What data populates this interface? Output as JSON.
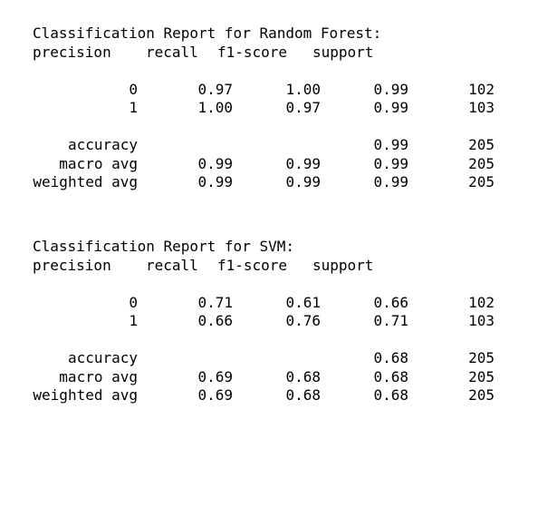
{
  "reports": [
    {
      "title": "Classification Report for Random Forest:",
      "headers": {
        "precision": "precision",
        "recall": "recall",
        "f1": "f1-score",
        "support": "support"
      },
      "class_rows": [
        {
          "label": "0",
          "precision": "0.97",
          "recall": "1.00",
          "f1": "0.99",
          "support": "102"
        },
        {
          "label": "1",
          "precision": "1.00",
          "recall": "0.97",
          "f1": "0.99",
          "support": "103"
        }
      ],
      "summary_rows": [
        {
          "label": "accuracy",
          "precision": "",
          "recall": "",
          "f1": "0.99",
          "support": "205"
        },
        {
          "label": "macro avg",
          "precision": "0.99",
          "recall": "0.99",
          "f1": "0.99",
          "support": "205"
        },
        {
          "label": "weighted avg",
          "precision": "0.99",
          "recall": "0.99",
          "f1": "0.99",
          "support": "205"
        }
      ]
    },
    {
      "title": "Classification Report for SVM:",
      "headers": {
        "precision": "precision",
        "recall": "recall",
        "f1": "f1-score",
        "support": "support"
      },
      "class_rows": [
        {
          "label": "0",
          "precision": "0.71",
          "recall": "0.61",
          "f1": "0.66",
          "support": "102"
        },
        {
          "label": "1",
          "precision": "0.66",
          "recall": "0.76",
          "f1": "0.71",
          "support": "103"
        }
      ],
      "summary_rows": [
        {
          "label": "accuracy",
          "precision": "",
          "recall": "",
          "f1": "0.68",
          "support": "205"
        },
        {
          "label": "macro avg",
          "precision": "0.69",
          "recall": "0.68",
          "f1": "0.68",
          "support": "205"
        },
        {
          "label": "weighted avg",
          "precision": "0.69",
          "recall": "0.68",
          "f1": "0.68",
          "support": "205"
        }
      ]
    }
  ]
}
